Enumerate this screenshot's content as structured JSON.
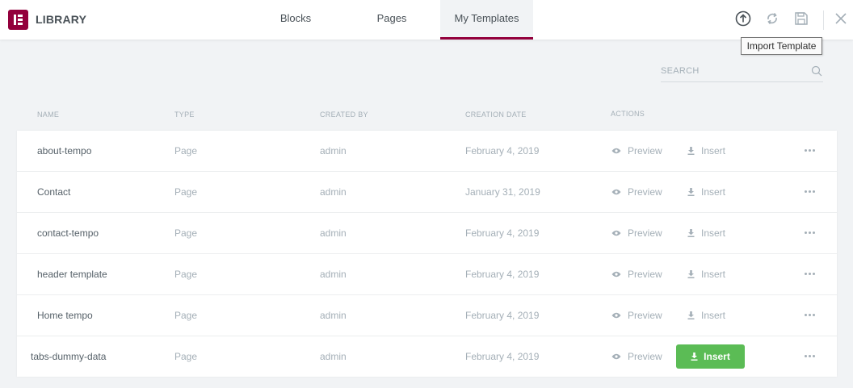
{
  "header": {
    "title": "LIBRARY",
    "tabs": [
      {
        "label": "Blocks"
      },
      {
        "label": "Pages"
      },
      {
        "label": "My Templates"
      }
    ],
    "active_tab": "My Templates",
    "icons": [
      "import-icon",
      "sync-icon",
      "save-icon",
      "close-icon"
    ],
    "tooltip": "Import Template"
  },
  "search": {
    "placeholder": "SEARCH"
  },
  "columns": [
    "NAME",
    "TYPE",
    "CREATED BY",
    "CREATION DATE",
    "ACTIONS"
  ],
  "actions": {
    "preview": "Preview",
    "insert": "Insert"
  },
  "templates": [
    {
      "name": "about-tempo",
      "type": "Page",
      "created_by": "admin",
      "date": "February 4, 2019"
    },
    {
      "name": "Contact",
      "type": "Page",
      "created_by": "admin",
      "date": "January 31, 2019"
    },
    {
      "name": "contact-tempo",
      "type": "Page",
      "created_by": "admin",
      "date": "February 4, 2019"
    },
    {
      "name": "header template",
      "type": "Page",
      "created_by": "admin",
      "date": "February 4, 2019"
    },
    {
      "name": "Home tempo",
      "type": "Page",
      "created_by": "admin",
      "date": "February 4, 2019"
    },
    {
      "name": "tabs-dummy-data",
      "type": "Page",
      "created_by": "admin",
      "date": "February 4, 2019"
    }
  ],
  "colors": {
    "brand": "#93003c",
    "insert_button": "#5bbc55",
    "background": "#f1f3f5"
  }
}
